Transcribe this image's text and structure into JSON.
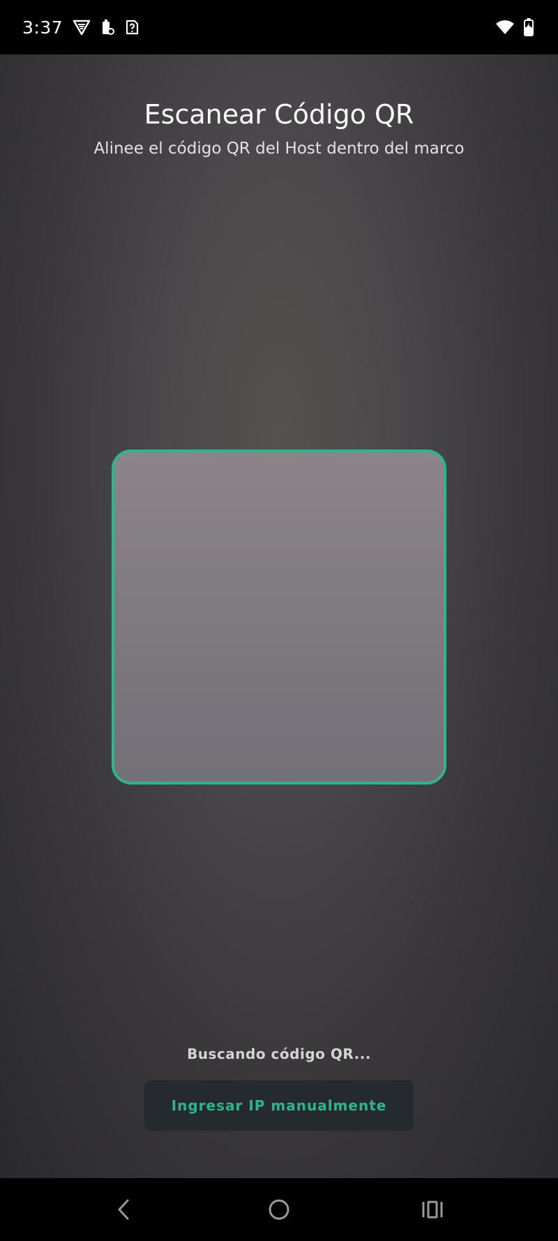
{
  "status_bar": {
    "time": "3:37",
    "left_icons": [
      "vpn-icon",
      "battery-saver-icon",
      "unknown-sim-icon"
    ],
    "right_icons": [
      "wifi-icon",
      "battery-charging-icon"
    ]
  },
  "scanner": {
    "title": "Escanear Código QR",
    "subtitle": "Alinee el código QR del Host dentro del marco",
    "status": "Buscando código QR...",
    "manual_button_label": "Ingresar IP manualmente"
  },
  "nav_bar": {
    "buttons": [
      "back-icon",
      "home-icon",
      "recents-icon"
    ]
  },
  "colors": {
    "accent": "#2bb789",
    "button_bg": "#252a2e",
    "background_top": "#54524f",
    "background_bottom": "#2a292b"
  }
}
